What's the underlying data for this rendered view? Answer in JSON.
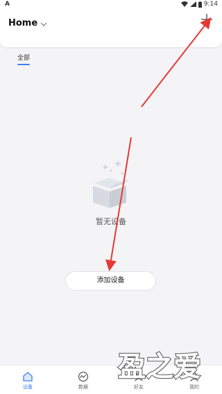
{
  "status_bar": {
    "left_icon": "A",
    "time": "9:14"
  },
  "header": {
    "title": "Home",
    "chevron_icon": "chevron-down-icon",
    "add_icon": "plus-icon"
  },
  "tabs": [
    {
      "label": "全部",
      "active": true
    }
  ],
  "empty_state": {
    "icon": "empty-box-icon",
    "message": "暂无设备"
  },
  "add_device_button": {
    "label": "添加设备"
  },
  "bottom_nav": [
    {
      "label": "设备",
      "icon": "home-device-icon",
      "active": true
    },
    {
      "label": "数据",
      "icon": "chart-data-icon",
      "active": false
    },
    {
      "label": "好友",
      "icon": "friends-icon",
      "active": false
    },
    {
      "label": "我的",
      "icon": "profile-icon",
      "active": false
    }
  ],
  "watermark": {
    "text": "盈之爱"
  },
  "colors": {
    "accent": "#3f7ff0",
    "annotation_arrow": "#e53935",
    "background": "#f4f4f6"
  }
}
